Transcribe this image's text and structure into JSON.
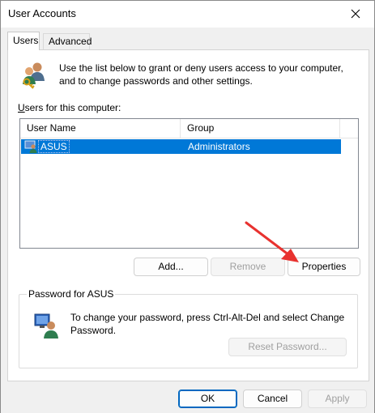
{
  "window": {
    "title": "User Accounts"
  },
  "tabs": [
    {
      "label": "Users",
      "active": true
    },
    {
      "label": "Advanced",
      "active": false
    }
  ],
  "intro": {
    "text": "Use the list below to grant or deny users access to your computer, and to change passwords and other settings."
  },
  "users_section": {
    "label": "Users for this computer:",
    "columns": [
      "User Name",
      "Group"
    ],
    "rows": [
      {
        "name": "ASUS",
        "group": "Administrators",
        "selected": true
      }
    ]
  },
  "user_buttons": {
    "add": "Add...",
    "remove": "Remove",
    "properties": "Properties"
  },
  "password_group": {
    "title": "Password for ASUS",
    "text": "To change your password, press Ctrl-Alt-Del and select Change Password.",
    "reset_button": "Reset Password..."
  },
  "dialog_buttons": {
    "ok": "OK",
    "cancel": "Cancel",
    "apply": "Apply"
  },
  "colors": {
    "selection": "#0078d7",
    "accent": "#0067c0",
    "arrow": "#e8322f"
  },
  "icons": [
    "close-icon",
    "users-keys-icon",
    "user-icon",
    "user-monitor-icon",
    "arrow-annotation"
  ]
}
